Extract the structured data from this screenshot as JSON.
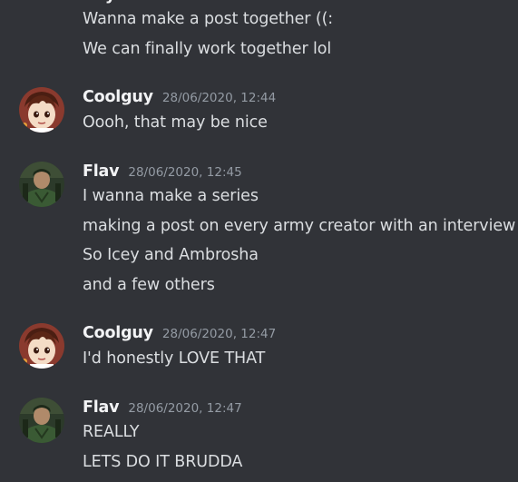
{
  "messages": [
    {
      "continuation_lines": [
        "Wanna make a post together ((:",
        "We can finally work together lol"
      ]
    },
    {
      "author": "Coolguy",
      "timestamp": "28/06/2020, 12:44",
      "avatar_icon": "anime-character-avatar",
      "lines": [
        "Oooh, that may be nice"
      ]
    },
    {
      "author": "Flav",
      "timestamp": "28/06/2020, 12:45",
      "avatar_icon": "soldier-avatar",
      "lines": [
        "I wanna make a series",
        "making a post on every army creator with an interview",
        "So Icey and Ambrosha",
        "and a few others"
      ]
    },
    {
      "author": "Coolguy",
      "timestamp": "28/06/2020, 12:47",
      "avatar_icon": "anime-character-avatar",
      "lines": [
        "I'd honestly LOVE THAT"
      ]
    },
    {
      "author": "Flav",
      "timestamp": "28/06/2020, 12:47",
      "avatar_icon": "soldier-avatar",
      "lines": [
        "REALLY",
        "LETS DO IT BRUDDA"
      ]
    }
  ]
}
